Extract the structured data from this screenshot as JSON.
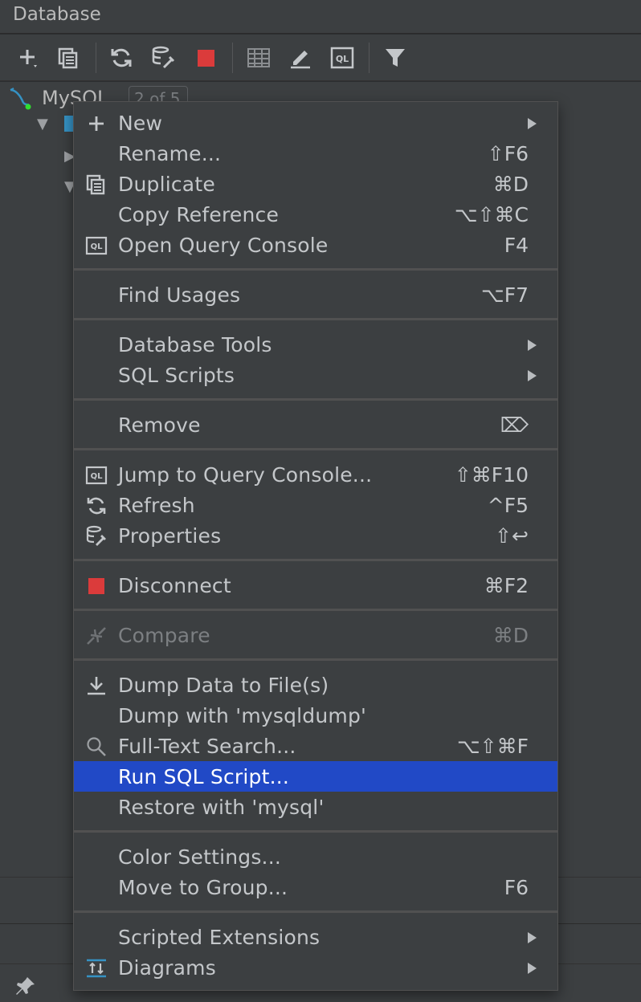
{
  "panel": {
    "title": "Database"
  },
  "tree": {
    "root_label": "MySQL",
    "badge": "2 of 5"
  },
  "menu": {
    "items": [
      {
        "label": "New",
        "shortcut": "",
        "icon": "plus-icon",
        "submenu": true
      },
      {
        "label": "Rename...",
        "shortcut": "⇧F6",
        "icon": "",
        "submenu": false
      },
      {
        "label": "Duplicate",
        "shortcut": "⌘D",
        "icon": "duplicate-icon",
        "submenu": false
      },
      {
        "label": "Copy Reference",
        "shortcut": "⌥⇧⌘C",
        "icon": "",
        "submenu": false
      },
      {
        "label": "Open Query Console",
        "shortcut": "F4",
        "icon": "ql-console-icon",
        "submenu": false
      },
      {
        "label": "Find Usages",
        "shortcut": "⌥F7",
        "icon": "",
        "submenu": false
      },
      {
        "label": "Database Tools",
        "shortcut": "",
        "icon": "",
        "submenu": true
      },
      {
        "label": "SQL Scripts",
        "shortcut": "",
        "icon": "",
        "submenu": true
      },
      {
        "label": "Remove",
        "shortcut": "⌦",
        "icon": "",
        "submenu": false
      },
      {
        "label": "Jump to Query Console...",
        "shortcut": "⇧⌘F10",
        "icon": "ql-console-icon",
        "submenu": false
      },
      {
        "label": "Refresh",
        "shortcut": "^F5",
        "icon": "refresh-icon",
        "submenu": false
      },
      {
        "label": "Properties",
        "shortcut": "⇧↩",
        "icon": "properties-icon",
        "submenu": false
      },
      {
        "label": "Disconnect",
        "shortcut": "⌘F2",
        "icon": "stop-icon",
        "submenu": false
      },
      {
        "label": "Compare",
        "shortcut": "⌘D",
        "icon": "compare-icon",
        "submenu": false,
        "disabled": true
      },
      {
        "label": "Dump Data to File(s)",
        "shortcut": "",
        "icon": "download-icon",
        "submenu": false
      },
      {
        "label": "Dump with 'mysqldump'",
        "shortcut": "",
        "icon": "",
        "submenu": false
      },
      {
        "label": "Full-Text Search...",
        "shortcut": "⌥⇧⌘F",
        "icon": "search-icon",
        "submenu": false
      },
      {
        "label": "Run SQL Script...",
        "shortcut": "",
        "icon": "",
        "submenu": false,
        "selected": true
      },
      {
        "label": "Restore with 'mysql'",
        "shortcut": "",
        "icon": "",
        "submenu": false
      },
      {
        "label": "Color Settings...",
        "shortcut": "",
        "icon": "",
        "submenu": false
      },
      {
        "label": "Move to Group...",
        "shortcut": "F6",
        "icon": "",
        "submenu": false
      },
      {
        "label": "Scripted Extensions",
        "shortcut": "",
        "icon": "",
        "submenu": true
      },
      {
        "label": "Diagrams",
        "shortcut": "",
        "icon": "diagram-icon",
        "submenu": true
      }
    ]
  },
  "colors": {
    "background": "#3c3f41",
    "selection": "#2149c6",
    "stop": "#db3b3b",
    "accent_blue": "#3592c4"
  }
}
